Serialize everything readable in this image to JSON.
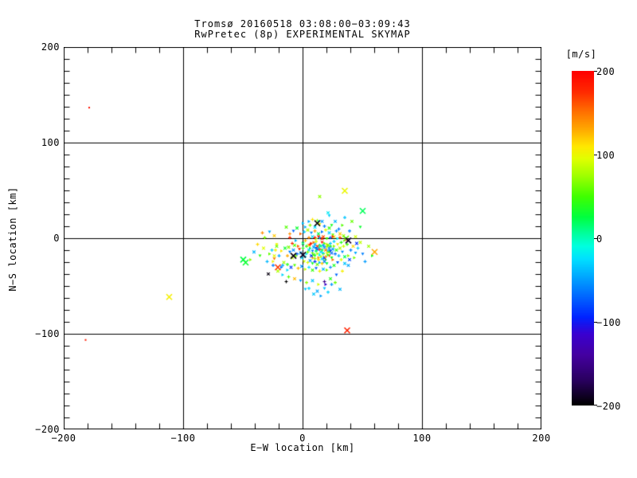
{
  "title": {
    "line1": "Tromsø 20160518 03:08:00−03:09:43",
    "line2": "RwPretec (8p) EXPERIMENTAL SKYMAP"
  },
  "chart_data": {
    "type": "scatter",
    "xlabel": "E−W location [km]",
    "ylabel": "N−S location [km]",
    "xlim": [
      -200,
      200
    ],
    "ylim": [
      -200,
      200
    ],
    "x_ticks": [
      -200,
      -100,
      0,
      100,
      200
    ],
    "y_ticks": [
      -200,
      -100,
      0,
      100,
      200
    ],
    "x_tick_labels": [
      "−200",
      "−100",
      "0",
      "100",
      "200"
    ],
    "y_tick_labels": [
      "−200",
      "−100",
      "0",
      "100",
      "200"
    ],
    "x_minor_per_major": 5,
    "y_minor_per_major": 8,
    "grid": true,
    "points_format": "[x_km, y_km, velocity_ms, size_class] size: 0=tiny dot, 1=small marker, 2=large X",
    "points": [
      [
        3,
        -8,
        45
      ],
      [
        5,
        -12,
        -30
      ],
      [
        7,
        -5,
        170
      ],
      [
        8,
        -15,
        60
      ],
      [
        9,
        -9,
        -45
      ],
      [
        10,
        -18,
        25
      ],
      [
        11,
        -3,
        95
      ],
      [
        12,
        -11,
        -80
      ],
      [
        13,
        -20,
        140
      ],
      [
        14,
        -7,
        30
      ],
      [
        15,
        -14,
        -25
      ],
      [
        16,
        -4,
        185
      ],
      [
        17,
        -16,
        70
      ],
      [
        18,
        -9,
        -55
      ],
      [
        19,
        -22,
        50
      ],
      [
        20,
        -6,
        110
      ],
      [
        21,
        -13,
        -35
      ],
      [
        22,
        -18,
        160
      ],
      [
        23,
        -8,
        40
      ],
      [
        24,
        -15,
        -70
      ],
      [
        6,
        -10,
        15
      ],
      [
        8,
        -20,
        130
      ],
      [
        10,
        -6,
        -40
      ],
      [
        12,
        -16,
        80
      ],
      [
        14,
        -11,
        175
      ],
      [
        16,
        -21,
        -20
      ],
      [
        18,
        -5,
        55
      ],
      [
        20,
        -15,
        100
      ],
      [
        22,
        -10,
        -60
      ],
      [
        24,
        -20,
        35
      ],
      [
        4,
        -14,
        65
      ],
      [
        7,
        -18,
        -90
      ],
      [
        9,
        -4,
        150
      ],
      [
        11,
        -13,
        20
      ],
      [
        13,
        -9,
        -15
      ],
      [
        15,
        -19,
        90
      ],
      [
        17,
        -7,
        -50
      ],
      [
        19,
        -12,
        145
      ],
      [
        21,
        -17,
        45
      ],
      [
        23,
        -5,
        -35
      ],
      [
        5,
        -7,
        120
      ],
      [
        8,
        -13,
        -65
      ],
      [
        10,
        -21,
        75
      ],
      [
        12,
        -8,
        165
      ],
      [
        14,
        -17,
        -10
      ],
      [
        16,
        -12,
        30
      ],
      [
        18,
        -20,
        -100
      ],
      [
        20,
        -9,
        85
      ],
      [
        22,
        -14,
        55
      ],
      [
        25,
        -11,
        -45
      ],
      [
        3,
        -16,
        -20
      ],
      [
        6,
        -6,
        190
      ],
      [
        9,
        -17,
        50
      ],
      [
        11,
        -10,
        -75
      ],
      [
        13,
        -22,
        115
      ],
      [
        15,
        -8,
        10
      ],
      [
        17,
        -15,
        -30
      ],
      [
        19,
        -19,
        135
      ],
      [
        21,
        -7,
        60
      ],
      [
        23,
        -13,
        -85
      ],
      [
        0,
        -10,
        40
      ],
      [
        -2,
        -15,
        -40
      ],
      [
        -4,
        -8,
        155
      ],
      [
        -6,
        -18,
        65
      ],
      [
        -8,
        -12,
        -55
      ],
      [
        1,
        -24,
        90
      ],
      [
        2,
        -2,
        125
      ],
      [
        -1,
        -20,
        -25
      ],
      [
        26,
        -8,
        70
      ],
      [
        27,
        -16,
        -65
      ],
      [
        28,
        -12,
        45
      ],
      [
        29,
        -6,
        105
      ],
      [
        30,
        -18,
        -40
      ],
      [
        31,
        -10,
        80
      ],
      [
        25,
        -22,
        150
      ],
      [
        26,
        -3,
        -30
      ],
      [
        0,
        -5,
        15
      ],
      [
        -3,
        -11,
        175
      ],
      [
        -5,
        -16,
        -70
      ],
      [
        -7,
        -7,
        55
      ],
      [
        2,
        -19,
        -15
      ],
      [
        4,
        -25,
        95
      ],
      [
        6,
        -23,
        -50
      ],
      [
        8,
        -26,
        35
      ],
      [
        10,
        -24,
        -90
      ],
      [
        12,
        -27,
        60
      ],
      [
        14,
        -25,
        -35
      ],
      [
        16,
        -26,
        120
      ],
      [
        18,
        -24,
        -60
      ],
      [
        20,
        -26,
        25
      ],
      [
        5,
        1,
        140
      ],
      [
        8,
        2,
        -25
      ],
      [
        11,
        0,
        75
      ],
      [
        14,
        1,
        -45
      ],
      [
        17,
        2,
        160
      ],
      [
        20,
        0,
        50
      ],
      [
        23,
        1,
        -70
      ],
      [
        26,
        2,
        100
      ],
      [
        29,
        0,
        -20
      ],
      [
        32,
        -4,
        40
      ],
      [
        -9,
        -20,
        85
      ],
      [
        -11,
        -14,
        -60
      ],
      [
        -13,
        -18,
        130
      ],
      [
        -15,
        -10,
        30
      ],
      [
        -6,
        -2,
        -40
      ],
      [
        -9,
        -5,
        180
      ],
      [
        -12,
        -9,
        65
      ],
      [
        33,
        -14,
        -55
      ],
      [
        34,
        -8,
        90
      ],
      [
        35,
        -19,
        20
      ],
      [
        -18,
        -13,
        110
      ],
      [
        -20,
        -18,
        -45
      ],
      [
        -22,
        -8,
        60
      ],
      [
        -24,
        -21,
        145
      ],
      [
        -26,
        -12,
        -30
      ],
      [
        -16,
        -25,
        75
      ],
      [
        -18,
        -30,
        -65
      ],
      [
        -13,
        -27,
        40
      ],
      [
        -10,
        -30,
        -85
      ],
      [
        -7,
        -28,
        55
      ],
      [
        -4,
        -31,
        125
      ],
      [
        -1,
        -29,
        -50
      ],
      [
        2,
        -32,
        85
      ],
      [
        5,
        -30,
        -25
      ],
      [
        8,
        -33,
        45
      ],
      [
        11,
        -31,
        -70
      ],
      [
        14,
        -34,
        105
      ],
      [
        17,
        -32,
        -40
      ],
      [
        20,
        -33,
        65
      ],
      [
        23,
        -30,
        -55
      ],
      [
        26,
        -28,
        35
      ],
      [
        29,
        -25,
        -75
      ],
      [
        32,
        -22,
        95
      ],
      [
        35,
        -26,
        -35
      ],
      [
        38,
        -18,
        70
      ],
      [
        40,
        -12,
        -60
      ],
      [
        42,
        -8,
        115
      ],
      [
        44,
        -15,
        -45
      ],
      [
        37,
        -6,
        50
      ],
      [
        39,
        -22,
        -80
      ],
      [
        -2,
        5,
        155
      ],
      [
        1,
        7,
        -35
      ],
      [
        4,
        9,
        80
      ],
      [
        7,
        6,
        -55
      ],
      [
        10,
        8,
        135
      ],
      [
        13,
        5,
        25
      ],
      [
        16,
        7,
        -65
      ],
      [
        19,
        9,
        95
      ],
      [
        22,
        6,
        -30
      ],
      [
        25,
        4,
        60
      ],
      [
        28,
        8,
        -50
      ],
      [
        31,
        5,
        120
      ],
      [
        2,
        12,
        -40
      ],
      [
        6,
        14,
        70
      ],
      [
        10,
        12,
        -25
      ],
      [
        14,
        15,
        100
      ],
      [
        18,
        13,
        -60
      ],
      [
        22,
        11,
        45
      ],
      [
        5,
        18,
        -45
      ],
      [
        12,
        19,
        85
      ],
      [
        -5,
        11,
        30
      ],
      [
        -8,
        8,
        -70
      ],
      [
        -11,
        5,
        140
      ],
      [
        -14,
        12,
        55
      ],
      [
        0,
        16,
        -35
      ],
      [
        8,
        20,
        110
      ],
      [
        16,
        18,
        -50
      ],
      [
        24,
        14,
        35
      ],
      [
        30,
        10,
        -65
      ],
      [
        34,
        3,
        75
      ],
      [
        -28,
        -16,
        60
      ],
      [
        -30,
        -24,
        -40
      ],
      [
        -33,
        -10,
        95
      ],
      [
        -36,
        -18,
        45
      ],
      [
        -25,
        -28,
        -60
      ],
      [
        -21,
        -34,
        80
      ],
      [
        -17,
        -38,
        -30
      ],
      [
        -12,
        -40,
        55
      ],
      [
        -7,
        -42,
        125
      ],
      [
        -2,
        -44,
        -50
      ],
      [
        3,
        -46,
        70
      ],
      [
        8,
        -44,
        -35
      ],
      [
        13,
        -48,
        90
      ],
      [
        18,
        -45,
        -150
      ],
      [
        23,
        -42,
        40
      ],
      [
        28,
        -38,
        -70
      ],
      [
        33,
        -34,
        105
      ],
      [
        38,
        -28,
        -45
      ],
      [
        43,
        -20,
        65
      ],
      [
        46,
        -10,
        -30
      ],
      [
        48,
        -4,
        85
      ],
      [
        50,
        -16,
        -60
      ],
      [
        -38,
        -6,
        115
      ],
      [
        -41,
        -14,
        -40
      ],
      [
        -44,
        -22,
        70
      ],
      [
        5,
        -52,
        -28
      ],
      [
        12,
        -55,
        -45
      ],
      [
        18,
        -52,
        -38
      ],
      [
        24,
        -48,
        -52
      ],
      [
        9,
        -58,
        -33
      ],
      [
        15,
        -60,
        -48
      ],
      [
        21,
        -56,
        -30
      ],
      [
        -24,
        3,
        120
      ],
      [
        -28,
        7,
        -45
      ],
      [
        -32,
        1,
        65
      ],
      [
        27,
        18,
        -40
      ],
      [
        33,
        14,
        55
      ],
      [
        39,
        8,
        -60
      ],
      [
        44,
        2,
        90
      ],
      [
        48,
        12,
        30
      ],
      [
        52,
        -24,
        -50
      ],
      [
        55,
        -8,
        75
      ],
      [
        58,
        -18,
        40
      ],
      [
        35,
        22,
        -35
      ],
      [
        41,
        18,
        60
      ],
      [
        -22,
        -6,
        100
      ],
      [
        -23,
        -12,
        105
      ],
      [
        -24,
        -18,
        98
      ],
      [
        -25,
        -24,
        102
      ],
      [
        -34,
        6,
        140
      ],
      [
        14,
        44,
        70
      ],
      [
        22,
        24,
        -30
      ],
      [
        -11,
        1,
        180
      ],
      [
        45,
        -5,
        -90
      ],
      [
        19,
        -48,
        -120
      ],
      [
        27,
        -46,
        60
      ],
      [
        31,
        -53,
        -40
      ],
      [
        2,
        -53,
        -35
      ],
      [
        -14,
        -45,
        -200
      ],
      [
        -29,
        -37,
        -195
      ],
      [
        -13,
        -33,
        -25
      ],
      [
        -17,
        -28,
        -45
      ],
      [
        21,
        27,
        -20
      ],
      [
        13,
        18,
        -15
      ],
      [
        10,
        1,
        185
      ],
      [
        16,
        0,
        175
      ],
      [
        25,
        2,
        180
      ],
      [
        31,
        1,
        165
      ],
      [
        36,
        -1,
        170
      ],
      [
        13,
        2,
        190
      ],
      [
        -179,
        137,
        190,
        0
      ],
      [
        -182,
        -106,
        185,
        0
      ],
      [
        -112,
        -61,
        105,
        2
      ],
      [
        37,
        -96,
        180,
        2
      ],
      [
        60,
        -14,
        130,
        2
      ],
      [
        50,
        29,
        20,
        2
      ],
      [
        35,
        50,
        100,
        2
      ],
      [
        12,
        16,
        -200,
        2
      ],
      [
        -50,
        -22,
        25,
        2
      ],
      [
        -48,
        -25,
        30,
        2
      ],
      [
        -21,
        -30,
        170,
        2
      ],
      [
        36,
        0,
        55,
        2
      ],
      [
        -8,
        -18,
        -195,
        2
      ],
      [
        0,
        -17,
        -190,
        2
      ],
      [
        38,
        -2,
        -185,
        2
      ]
    ]
  },
  "colorbar": {
    "title": "[m/s]",
    "min": -200,
    "max": 200,
    "ticks": [
      200,
      100,
      0,
      -100,
      -200
    ],
    "tick_labels": [
      "200",
      "100",
      "0",
      "−100",
      "−200"
    ],
    "stops": [
      [
        -200,
        "#000000"
      ],
      [
        -170,
        "#2a0060"
      ],
      [
        -140,
        "#4400a0"
      ],
      [
        -115,
        "#3a00d0"
      ],
      [
        -95,
        "#0022ff"
      ],
      [
        -70,
        "#0066ff"
      ],
      [
        -45,
        "#00aaff"
      ],
      [
        -25,
        "#00e0ff"
      ],
      [
        -10,
        "#00ffe0"
      ],
      [
        5,
        "#00ffa0"
      ],
      [
        25,
        "#00ff40"
      ],
      [
        50,
        "#40ff00"
      ],
      [
        75,
        "#a0ff00"
      ],
      [
        95,
        "#e0ff00"
      ],
      [
        110,
        "#ffe800"
      ],
      [
        130,
        "#ffaa00"
      ],
      [
        155,
        "#ff6600"
      ],
      [
        175,
        "#ff2a00"
      ],
      [
        200,
        "#ff0000"
      ]
    ]
  }
}
